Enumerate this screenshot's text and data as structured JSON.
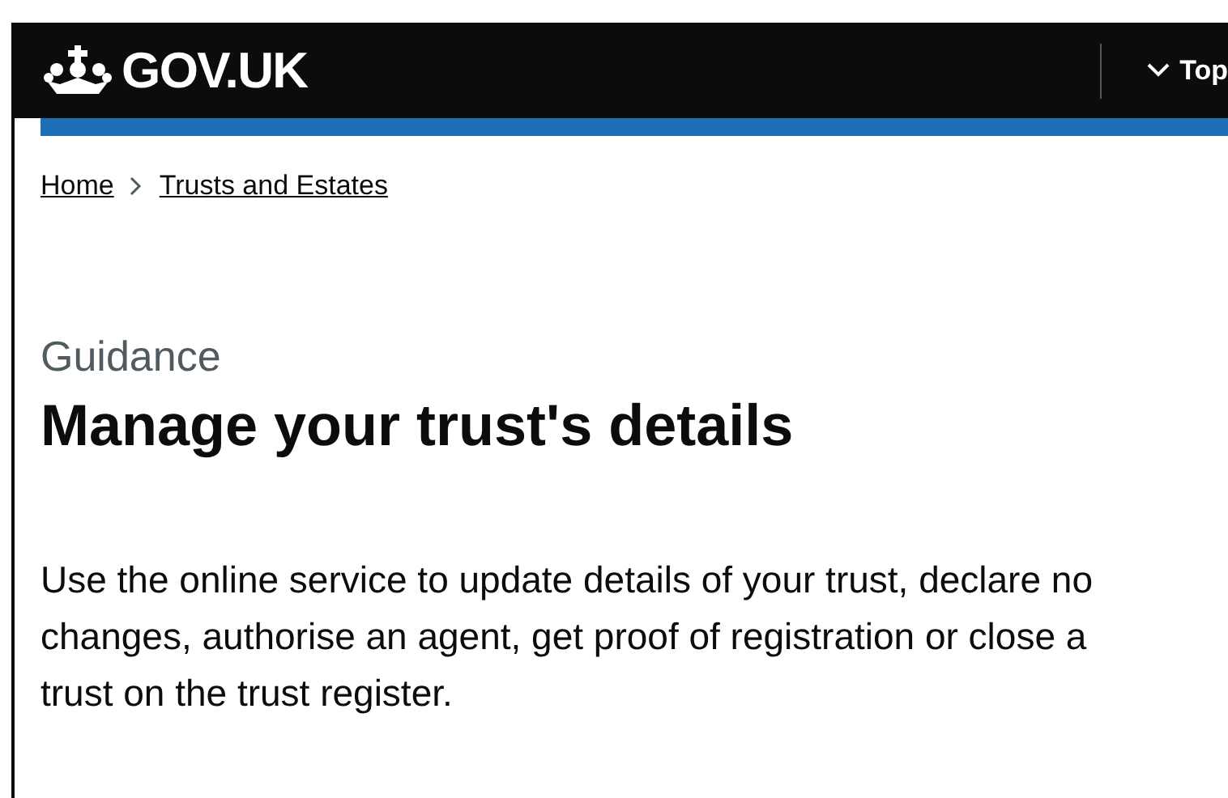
{
  "header": {
    "logo": "GOV.UK",
    "menu": "Top"
  },
  "breadcrumbs": [
    "Home",
    "Trusts and Estates"
  ],
  "caption": "Guidance",
  "title": "Manage your trust's details",
  "lead": "Use the online service to update details of your trust, declare no changes, authorise an agent, get proof of registration or close a trust on the trust register."
}
